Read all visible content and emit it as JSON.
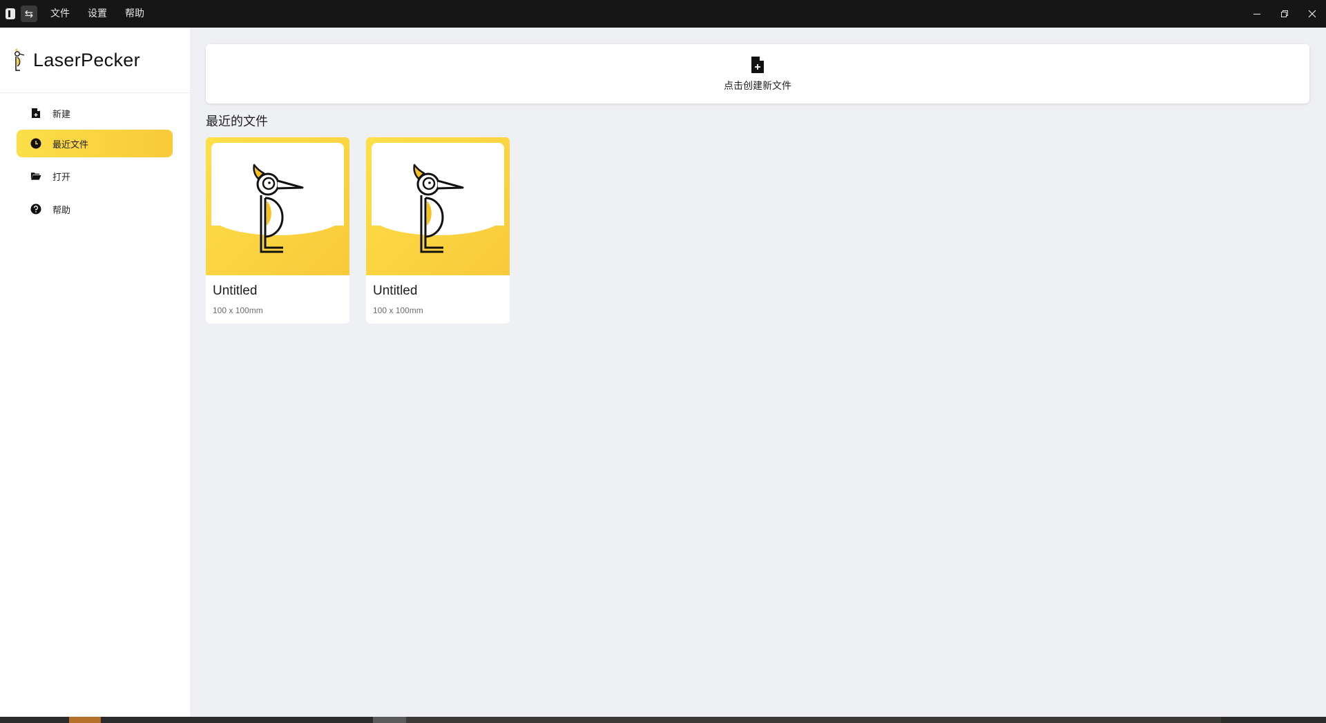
{
  "titlebar": {
    "menu": [
      "文件",
      "设置",
      "帮助"
    ],
    "toggle_glyph": "⇆"
  },
  "sidebar": {
    "logo_text": "LaserPecker",
    "items": [
      {
        "label": "新建",
        "icon": "file-plus-icon",
        "active": false
      },
      {
        "label": "最近文件",
        "icon": "clock-icon",
        "active": true
      },
      {
        "label": "打开",
        "icon": "folder-open-icon",
        "active": false
      },
      {
        "label": "帮助",
        "icon": "help-circle-icon",
        "active": false
      }
    ]
  },
  "main": {
    "new_file_label": "点击创建新文件",
    "recent_title": "最近的文件",
    "files": [
      {
        "name": "Untitled",
        "size": "100 x 100mm"
      },
      {
        "name": "Untitled",
        "size": "100 x 100mm"
      }
    ]
  },
  "colors": {
    "accent": "#fbd440",
    "titlebar": "#161616",
    "background": "#eff0f4"
  }
}
